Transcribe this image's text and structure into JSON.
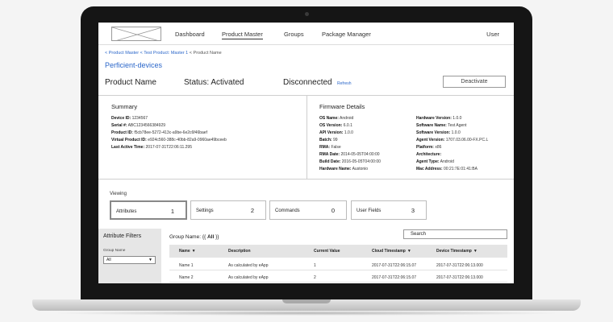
{
  "nav": {
    "items": [
      "Dashboard",
      "Product Master",
      "Groups",
      "Package Manager"
    ],
    "user": "User"
  },
  "breadcrumb": {
    "items": [
      "< Product Master",
      "< Test Product: Master 1",
      "< Product Name"
    ]
  },
  "subtitle": "Perficient-devices",
  "product": {
    "name": "Product Name",
    "status": "Status: Activated",
    "connection": "Disconnected",
    "refresh": "Refresh",
    "deactivate": "Deactivate"
  },
  "summary": {
    "title": "Summary",
    "fields": [
      {
        "label": "Device ID:",
        "value": "1234567"
      },
      {
        "label": "Serial #:",
        "value": "ABC1234566384929"
      },
      {
        "label": "Product ID:",
        "value": "f5cb78ee-5272-413c-a9be-6e2c6f46baef"
      },
      {
        "label": "Virtual Product ID:",
        "value": "e924c560-388c-40bb-82a9-0960ae49bceeb"
      },
      {
        "label": "Last Active Time:",
        "value": "2017-07-31T22:06:11.295"
      }
    ]
  },
  "firmware": {
    "title": "Firmware Details",
    "left": [
      {
        "label": "OS Name:",
        "value": "Android"
      },
      {
        "label": "OS Version:",
        "value": "6.0.1"
      },
      {
        "label": "API Version:",
        "value": "1.0.0"
      },
      {
        "label": "Batch:",
        "value": "99"
      },
      {
        "label": "RMA:",
        "value": "False"
      },
      {
        "label": "RMA Date:",
        "value": "2014-05-05T04:00:00"
      },
      {
        "label": "Build Date:",
        "value": "2016-05-05T04:00:00"
      },
      {
        "label": "Hardware Name:",
        "value": "Austonio"
      }
    ],
    "right": [
      {
        "label": "Hardware Version:",
        "value": "1.0.0"
      },
      {
        "label": "Software Name:",
        "value": "Test Agent"
      },
      {
        "label": "Software Version:",
        "value": "1.0.0"
      },
      {
        "label": "Agent Version:",
        "value": "1707.03.06.00-FX.PC.L"
      },
      {
        "label": "Platform:",
        "value": "x86"
      },
      {
        "label": "Architecture:",
        "value": ""
      },
      {
        "label": "Agent Type:",
        "value": "Android"
      },
      {
        "label": "Mac Address:",
        "value": "00:21:7E:01:41:BA"
      }
    ]
  },
  "viewing": {
    "label": "Viewing",
    "tabs": [
      {
        "label": "Attributes",
        "count": "1"
      },
      {
        "label": "Settings",
        "count": "2"
      },
      {
        "label": "Commands",
        "count": "0"
      },
      {
        "label": "User Fields",
        "count": "3"
      }
    ]
  },
  "filters": {
    "title": "Attribute Filters",
    "group_label": "Group Name",
    "group_value": "All"
  },
  "group_name": {
    "prefix": "Group Name: {{ ",
    "value": "All",
    "suffix": " }}"
  },
  "search": {
    "label": "Search"
  },
  "table": {
    "headers": [
      "Name",
      "Description",
      "Current Value",
      "Cloud Timestamp",
      "Device Timestamp"
    ],
    "rows": [
      [
        "Name 1",
        "As calculated by eApp",
        "1",
        "2017-07-31T22:06:15.07",
        "2017-07-31T22:06:13.000"
      ],
      [
        "Name 2",
        "As calculated by eApp",
        "2",
        "2017-07-31T22:06:15.07",
        "2017-07-31T22:06:13.000"
      ]
    ]
  },
  "icons": {
    "sort": "caret-down-icon",
    "dropdown": "caret-down-icon",
    "logo": "logo-placeholder"
  }
}
